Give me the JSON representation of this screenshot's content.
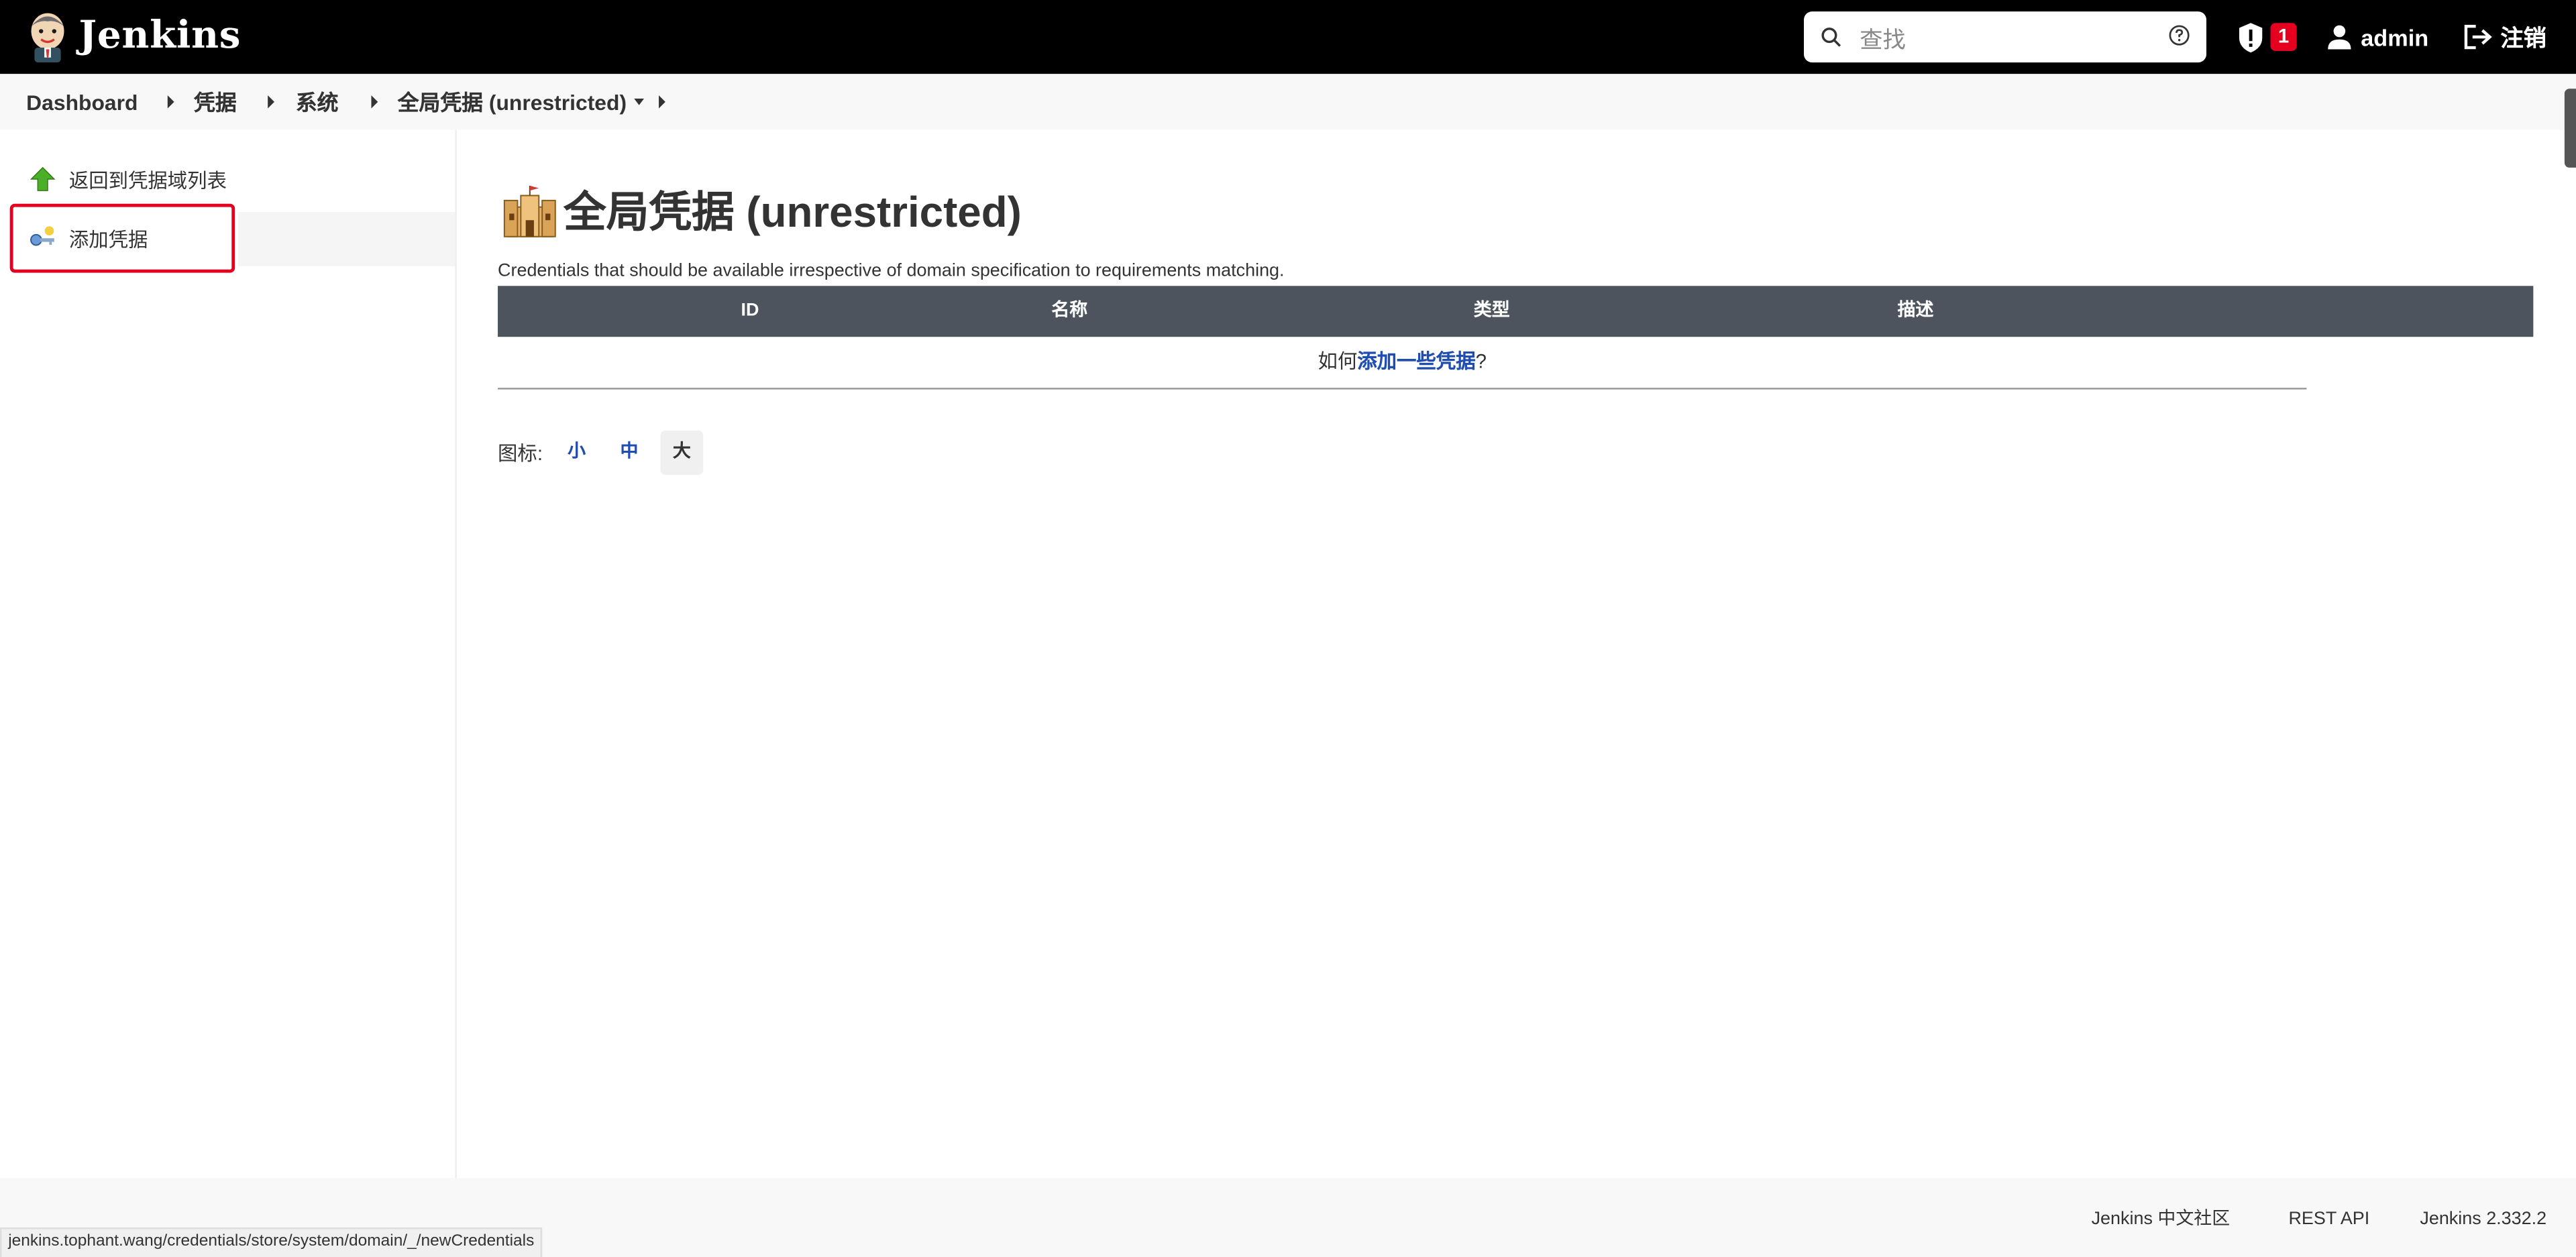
{
  "header": {
    "brand": "Jenkins",
    "search_placeholder": "查找",
    "security_badge_count": "1",
    "user_name": "admin",
    "logout_label": "注销"
  },
  "breadcrumb": {
    "items": [
      "Dashboard",
      "凭据",
      "系统",
      "全局凭据 (unrestricted)"
    ]
  },
  "sidebar": {
    "items": [
      {
        "label": "返回到凭据域列表"
      },
      {
        "label": "添加凭据"
      }
    ]
  },
  "main": {
    "title": "全局凭据 (unrestricted)",
    "description": "Credentials that should be available irrespective of domain specification to requirements matching.",
    "table_headers": [
      "ID",
      "名称",
      "类型",
      "描述"
    ],
    "empty_prefix": "如何",
    "empty_link": "添加一些凭据",
    "empty_suffix": "?",
    "icon_label": "图标:",
    "sizes": [
      "小",
      "中",
      "大"
    ],
    "selected_size": "大"
  },
  "footer": {
    "community": "Jenkins 中文社区",
    "rest_api": "REST API",
    "version": "Jenkins 2.332.2"
  },
  "status_bar": {
    "url": "jenkins.tophant.wang/credentials/store/system/domain/_/newCredentials"
  },
  "colors": {
    "header_bg": "#000000",
    "accent_link": "#1f4db1",
    "badge": "#e6001f",
    "table_header": "#4d545d"
  }
}
